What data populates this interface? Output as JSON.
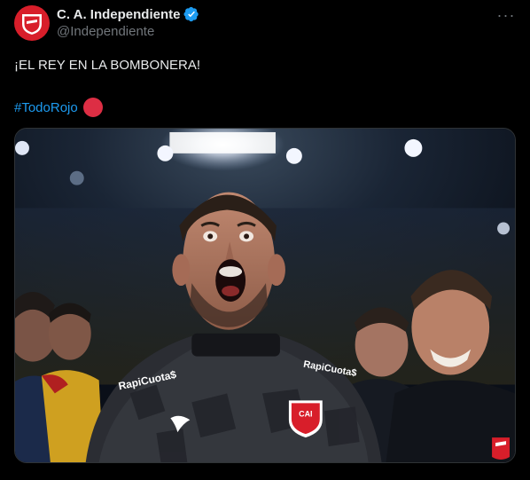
{
  "author": {
    "display_name": "C. A. Independiente",
    "handle": "@Independiente",
    "avatar_icon": "club-crest-icon",
    "verified_icon": "verified-badge-icon"
  },
  "tweet": {
    "text": "¡EL REY EN LA BOMBONERA!",
    "hashtag": "#TodoRojo",
    "emoji_icon": "red-circle-icon"
  },
  "media": {
    "type": "photo",
    "jersey_sponsor": "RapiCuota$",
    "crest_text": "CAI"
  },
  "menu": {
    "more_icon": "more-options-icon",
    "more_label": "···"
  },
  "colors": {
    "background": "#000000",
    "text": "#e7e9ea",
    "secondary": "#71767b",
    "link": "#1d9bf0",
    "brand_red": "#d81e2a",
    "verified": "#1d9bf0"
  }
}
